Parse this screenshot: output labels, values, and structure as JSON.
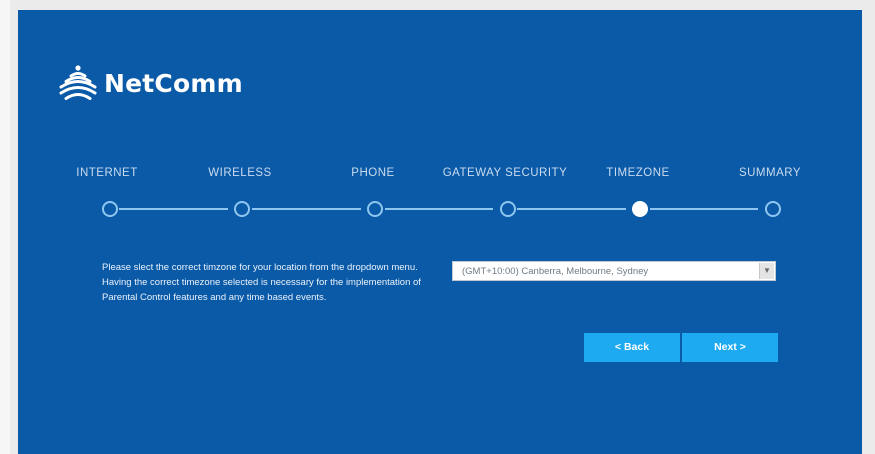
{
  "brand": {
    "name": "NetComm",
    "icon": "wifi-signal-icon"
  },
  "wizard": {
    "steps": [
      {
        "label": "INTERNET",
        "state": "pending"
      },
      {
        "label": "WIRELESS",
        "state": "pending"
      },
      {
        "label": "PHONE",
        "state": "pending"
      },
      {
        "label": "GATEWAY SECURITY",
        "state": "pending"
      },
      {
        "label": "TIMEZONE",
        "state": "active"
      },
      {
        "label": "SUMMARY",
        "state": "pending"
      }
    ]
  },
  "timezone": {
    "instructions": "Please slect the correct timzone for your location from the dropdown menu. Having the correct timezone selected is necessary for the implementation of Parental Control features and any time based events.",
    "selected": "(GMT+10:00) Canberra, Melbourne, Sydney"
  },
  "buttons": {
    "back_label": "< Back",
    "next_label": "Next >"
  },
  "colors": {
    "panel": "#0a5aa7",
    "accent": "#1eaaf1",
    "step_line": "#8fc6f0"
  }
}
